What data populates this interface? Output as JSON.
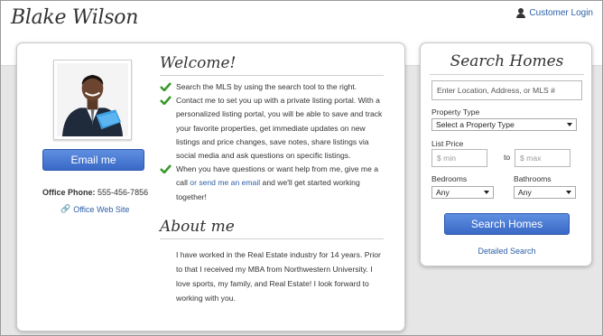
{
  "header": {
    "site_title": "Blake Wilson",
    "login_label": "Customer Login"
  },
  "profile": {
    "email_button": "Email me",
    "phone_label": "Office Phone:",
    "phone_value": "555-456-7856",
    "website_link": "Office Web Site"
  },
  "welcome": {
    "title": "Welcome!",
    "bullets": [
      {
        "text": "Search the MLS by using the search tool to the right."
      },
      {
        "text": "Contact me to set you up with a private listing portal. With a personalized listing portal, you will be able to save and track your favorite properties, get immediate updates on new listings and price changes, save notes, share listings via social media and ask questions on specific listings."
      },
      {
        "before": "When you have questions or want help from me, give me a call ",
        "link": "or send me an email",
        "after": " and we'll get started working together!"
      }
    ]
  },
  "about": {
    "title": "About me",
    "text": "I have worked in the Real Estate industry for 14 years. Prior to that I received my MBA from Northwestern University. I love sports, my family, and Real Estate! I look forward to working with you."
  },
  "search": {
    "title": "Search Homes",
    "location_placeholder": "Enter Location, Address, or MLS #",
    "property_type_label": "Property Type",
    "property_type_value": "Select a Property Type",
    "list_price_label": "List Price",
    "min_placeholder": "$ min",
    "to_label": "to",
    "max_placeholder": "$ max",
    "bedrooms_label": "Bedrooms",
    "bedrooms_value": "Any",
    "bathrooms_label": "Bathrooms",
    "bathrooms_value": "Any",
    "search_button": "Search Homes",
    "detailed_link": "Detailed Search"
  },
  "colors": {
    "accent": "#3a69c7",
    "link": "#2d5fa8",
    "check": "#3a9a2a",
    "background": "#e6e6e6"
  },
  "icons": {
    "login": "person-icon",
    "website": "link-icon",
    "bullet": "checkmark-icon"
  }
}
